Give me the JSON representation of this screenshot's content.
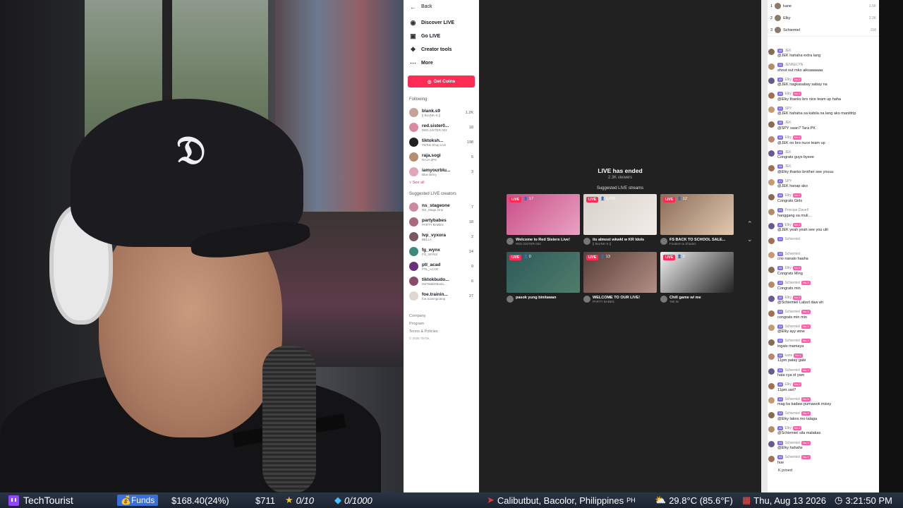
{
  "sidebar": {
    "nav": [
      {
        "label": "Back",
        "icon": "arrow-left-icon"
      },
      {
        "label": "Discover LIVE",
        "icon": "live-icon"
      },
      {
        "label": "Go LIVE",
        "icon": "camera-icon"
      },
      {
        "label": "Creator tools",
        "icon": "tools-icon"
      },
      {
        "label": "More",
        "icon": "more-icon"
      }
    ],
    "get_coins": "Get Coins",
    "following_title": "Following",
    "following": [
      {
        "name": "blank.s9",
        "sub": "|| BLVNK-S ||",
        "count": "1.2K",
        "color": "#c6a39a"
      },
      {
        "name": "red.sister0...",
        "sub": "RED.SISTER 002",
        "count": "18",
        "color": "#d98aa0"
      },
      {
        "name": "tiktoksh...",
        "sub": "TikTok Shop Live",
        "count": "198",
        "color": "#222222"
      },
      {
        "name": "raja.sogi",
        "sub": "RAJA 2PS",
        "count": "5",
        "color": "#b59070"
      },
      {
        "name": "iamyourblu...",
        "sub": "Blue Berry",
        "count": "3",
        "color": "#e0a6b8"
      }
    ],
    "see_all": "See all",
    "suggested_title": "Suggested LIVE creators",
    "suggested": [
      {
        "name": "ns_stageone",
        "sub": "NS_Stage One",
        "count": "7",
        "color": "#c98aa2"
      },
      {
        "name": "partybabes",
        "sub": "PARTY BABES",
        "count": "18",
        "color": "#a86a80"
      },
      {
        "name": "lvp_vyxora",
        "sub": "BELLA",
        "count": "2",
        "color": "#7a5a60"
      },
      {
        "name": "fg_wynx",
        "sub": "FG_WYNX",
        "count": "14",
        "color": "#3d8a7a"
      },
      {
        "name": "ptl_acad",
        "sub": "PTL_ACAD",
        "count": "9",
        "color": "#6a2f7a"
      },
      {
        "name": "tiktokbudo...",
        "sub": "MoTB&bKBudo...",
        "count": "6",
        "color": "#8a4a6a"
      },
      {
        "name": "foe.trainin...",
        "sub": "foe.trainingcamp",
        "count": "27",
        "color": "#e0d7d0"
      }
    ],
    "footer": [
      "Company",
      "Program",
      "Terms & Policies"
    ],
    "copyright": "© 2026 TikTok"
  },
  "live": {
    "ended_title": "LIVE has ended",
    "viewers": "2.3K viewers",
    "suggested_title": "Suggested LIVE streams",
    "badge": "LIVE",
    "cards": [
      {
        "viewers": "17",
        "title": "Welcome to Red Sisters Live!",
        "sub": "RED.SISTER 002",
        "colors": [
          "#c94e86",
          "#e8a3c2"
        ]
      },
      {
        "viewers": "1,029",
        "title": "its almost wkwkl w KR Idols",
        "sub": "|| BLVNK-S ||",
        "colors": [
          "#d8d2cc",
          "#f2ede8"
        ]
      },
      {
        "viewers": "12",
        "title": "FS BACK TO SCHOOL SALE...",
        "sub": "Footerm & Shades",
        "colors": [
          "#8a6d5a",
          "#e3c9b0"
        ]
      },
      {
        "viewers": "0",
        "title": "pasok yung binitawan",
        "sub": "",
        "colors": [
          "#2e5a5a",
          "#4f7d6a"
        ]
      },
      {
        "viewers": "13",
        "title": "WELCOME TO OUR LIVE!",
        "sub": "PARTY BABES",
        "colors": [
          "#5a3e3a",
          "#b38f84"
        ]
      },
      {
        "viewers": "0",
        "title": "Chill game w/ me",
        "sub": "Yeti W",
        "colors": [
          "#f2f2f2",
          "#222222"
        ]
      }
    ]
  },
  "chat": {
    "ranking": [
      {
        "pos": "1",
        "name": "kane",
        "score": "3.5K"
      },
      {
        "pos": "2",
        "name": "Elky",
        "score": "2.3K"
      },
      {
        "pos": "3",
        "name": "Schiemiel",
        "score": "158"
      }
    ],
    "messages": [
      {
        "user": "JEK",
        "text": "@JEK hahaha extra lang",
        "lvl": "45",
        "fan": ""
      },
      {
        "user": "JENNELYN",
        "text": "shout out mko aiksaaaaaa",
        "lvl": "12",
        "fan": ""
      },
      {
        "user": "Elky",
        "text": "@JEK nagkasabay sabay na",
        "lvl": "45",
        "fan": "No.3"
      },
      {
        "user": "Elky",
        "text": "@Elky thanks bro nice team up haha",
        "lvl": "45",
        "fan": "No.3"
      },
      {
        "user": "SPY",
        "text": "@JEK hahaha sa kabila na lang ako manittrip",
        "lvl": "41",
        "fan": ""
      },
      {
        "user": "JEK",
        "text": "@SPY saan? Tara PK",
        "lvl": "45",
        "fan": ""
      },
      {
        "user": "Elky",
        "text": "@JEK oo bro nuce team up",
        "lvl": "45",
        "fan": "No.3"
      },
      {
        "user": "JEK",
        "text": "Congrats guys byeee",
        "lvl": "45",
        "fan": ""
      },
      {
        "user": "JEK",
        "text": "@Elky thanks brother see youuu",
        "lvl": "45",
        "fan": ""
      },
      {
        "user": "SPY",
        "text": "@JEK hanap ako",
        "lvl": "41",
        "fan": ""
      },
      {
        "user": "Elky",
        "text": "Congrats Girls",
        "lvl": "45",
        "fan": "No.3"
      },
      {
        "user": "Principe Davell",
        "text": "hanggang sa muli...",
        "lvl": "21",
        "fan": ""
      },
      {
        "user": "Elky",
        "text": "@JEK yeah yeah see you ulit",
        "lvl": "45",
        "fan": "No.3"
      },
      {
        "user": "Schiemiel",
        "text": "",
        "lvl": "33",
        "fan": ""
      },
      {
        "user": "Schiemiel",
        "text": "cno nanalo haaha",
        "lvl": "33",
        "fan": ""
      },
      {
        "user": "Elky",
        "text": "Congrats Ming",
        "lvl": "45",
        "fan": "No.3"
      },
      {
        "user": "Schiemiel",
        "text": "Congrats min",
        "lvl": "33",
        "fan": "No.3"
      },
      {
        "user": "Elky",
        "text": "@Schiemiel Labsrl daw eh",
        "lvl": "45",
        "fan": "No.3"
      },
      {
        "user": "Schiemiel",
        "text": "congrats min min",
        "lvl": "33",
        "fan": "No.3"
      },
      {
        "user": "Schiemiel",
        "text": "@Elky ayy wow",
        "lvl": "33",
        "fan": "No.3"
      },
      {
        "user": "Schiemiel",
        "text": "ingats mamaya",
        "lvl": "33",
        "fan": "No.3"
      },
      {
        "user": "kane",
        "text": "11pm patay gabi",
        "lvl": "38",
        "fan": "No.1"
      },
      {
        "user": "Schiemiel",
        "text": "hala cya ol yam",
        "lvl": "33",
        "fan": "No.3"
      },
      {
        "user": "Elky",
        "text": "11pm uwi?",
        "lvl": "45",
        "fan": "No.3"
      },
      {
        "user": "Schiemiel",
        "text": "mag ka kadaw pumawok missy",
        "lvl": "33",
        "fan": "No.3"
      },
      {
        "user": "Schiemiel",
        "text": "@Elky lakos mo talaga",
        "lvl": "33",
        "fan": "No.3"
      },
      {
        "user": "Elky",
        "text": "@Schiemiel sila malakas",
        "lvl": "45",
        "fan": "No.3"
      },
      {
        "user": "Schiemiel",
        "text": "@Elky hahahs",
        "lvl": "33",
        "fan": "No.3"
      },
      {
        "user": "Schiemiel",
        "text": "hue",
        "lvl": "33",
        "fan": "No.3"
      }
    ],
    "joined": "K joined"
  },
  "overlay": {
    "channel": "TechTourist",
    "funds_label": "Funds",
    "funds_value": "$168.40(24%)",
    "money": "$711",
    "stars": "0/10",
    "gems": "0/1000",
    "location": "Calibutbut, Bacolor, Philippines",
    "country": "PH",
    "weather": "29.8°C (85.6°F)",
    "date": "Thu, Aug 13 2026",
    "time": "3:21:50 PM"
  },
  "colors": {
    "tiktok_red": "#fe2c55",
    "live_bg": "#212121",
    "bar_bg": "#1c2431",
    "twitch_purple": "#9146ff"
  }
}
